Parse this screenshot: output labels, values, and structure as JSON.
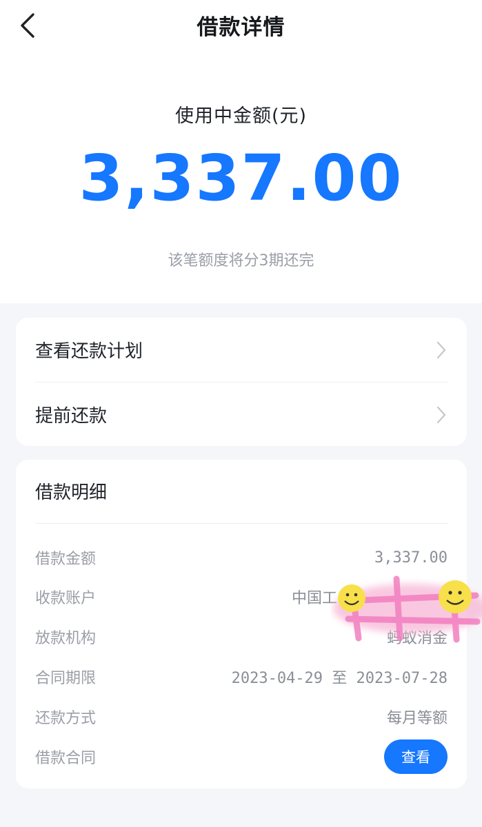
{
  "header": {
    "title": "借款详情",
    "back_icon": "chevron-left-icon"
  },
  "summary": {
    "label": "使用中金额(元)",
    "amount": "3,337.00",
    "installments_note": "该笔额度将分3期还完",
    "accent_color": "#1677ff"
  },
  "actions": [
    {
      "label": "查看还款计划",
      "icon": "chevron-right-icon"
    },
    {
      "label": "提前还款",
      "icon": "chevron-right-icon"
    }
  ],
  "details": {
    "title": "借款明细",
    "rows": [
      {
        "key": "借款金额",
        "value": "3,337.00"
      },
      {
        "key": "收款账户",
        "value": "中国工"
      },
      {
        "key": "放款机构",
        "value": "蚂蚁消金"
      },
      {
        "key": "合同期限",
        "value": "2023-04-29 至 2023-07-28"
      },
      {
        "key": "还款方式",
        "value": "每月等额"
      },
      {
        "key": "借款合同",
        "button": "查看"
      }
    ]
  }
}
